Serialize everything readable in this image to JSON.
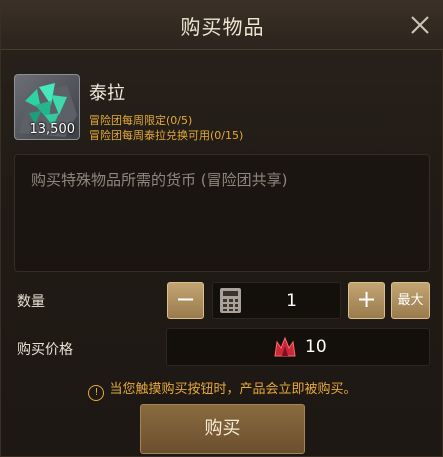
{
  "dialog": {
    "title": "购买物品",
    "close_icon": "close-x-icon"
  },
  "item": {
    "icon": "green-crystal-ore-icon",
    "quantity": "13,500",
    "name": "泰拉",
    "limits": [
      "冒险团每周限定(0/5)",
      "冒险团每周泰拉兑换可用(0/15)"
    ]
  },
  "description": "购买特殊物品所需的货币 (冒险团共享)",
  "quantity_row": {
    "label": "数量",
    "minus_label": "−",
    "value": "1",
    "plus_label": "+",
    "max_label": "最大",
    "calculator_icon": "calculator-icon"
  },
  "price_row": {
    "label": "购买价格",
    "currency_icon": "red-crown-currency-icon",
    "value": "10"
  },
  "notice": "当您触摸购买按钮时，产品会立即被购买。",
  "buy_label": "购买",
  "colors": {
    "accent_gold": "#e6a93a",
    "button_tan": "#b39363",
    "buy_button": "#7a5c36",
    "currency_red": "#c8283a"
  }
}
